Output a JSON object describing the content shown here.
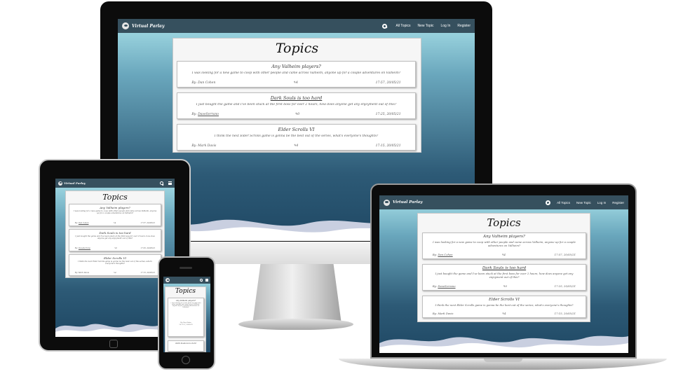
{
  "brand": "Virtual Parlay",
  "nav": [
    "All Topics",
    "New Topic",
    "Log In",
    "Register"
  ],
  "icons": {
    "logo": "skull-logo-icon",
    "search": "search-icon",
    "menu": "hamburger-menu-icon",
    "comments": "comment-icon"
  },
  "page_title": "Topics",
  "topics": [
    {
      "title": "Any Valheim players?",
      "body": "I was looking for a new game to coop with other people and came across Valheim, anyone up for a couple adventures on Valheim?",
      "author_prefix": "By:",
      "author": "Dan Cohen",
      "comments": "4",
      "date": "17:57, 20/05/21"
    },
    {
      "title": "Dark Souls is too hard",
      "body": "I just bought the game and I've been stuck at the first boss for over 2 hours, how does anyone get any enjoyment out of this?",
      "author_prefix": "By:",
      "author": "DaveSerrano",
      "comments": "0",
      "date": "17:25, 20/05/21"
    },
    {
      "title": "Elder Scrolls VI",
      "body": "I think the next Elder Scrolls game is gonna be the best out of the series, what's everyone's thoughts?",
      "author_prefix": "By:",
      "author": "Mark Davis",
      "comments": "4",
      "date": "17:15, 20/05/21"
    }
  ],
  "colors": {
    "navbar": "#36505e",
    "gradient_top": "#a8e0e8",
    "gradient_bottom": "#1f4864",
    "panel": "#f6f6f6"
  }
}
